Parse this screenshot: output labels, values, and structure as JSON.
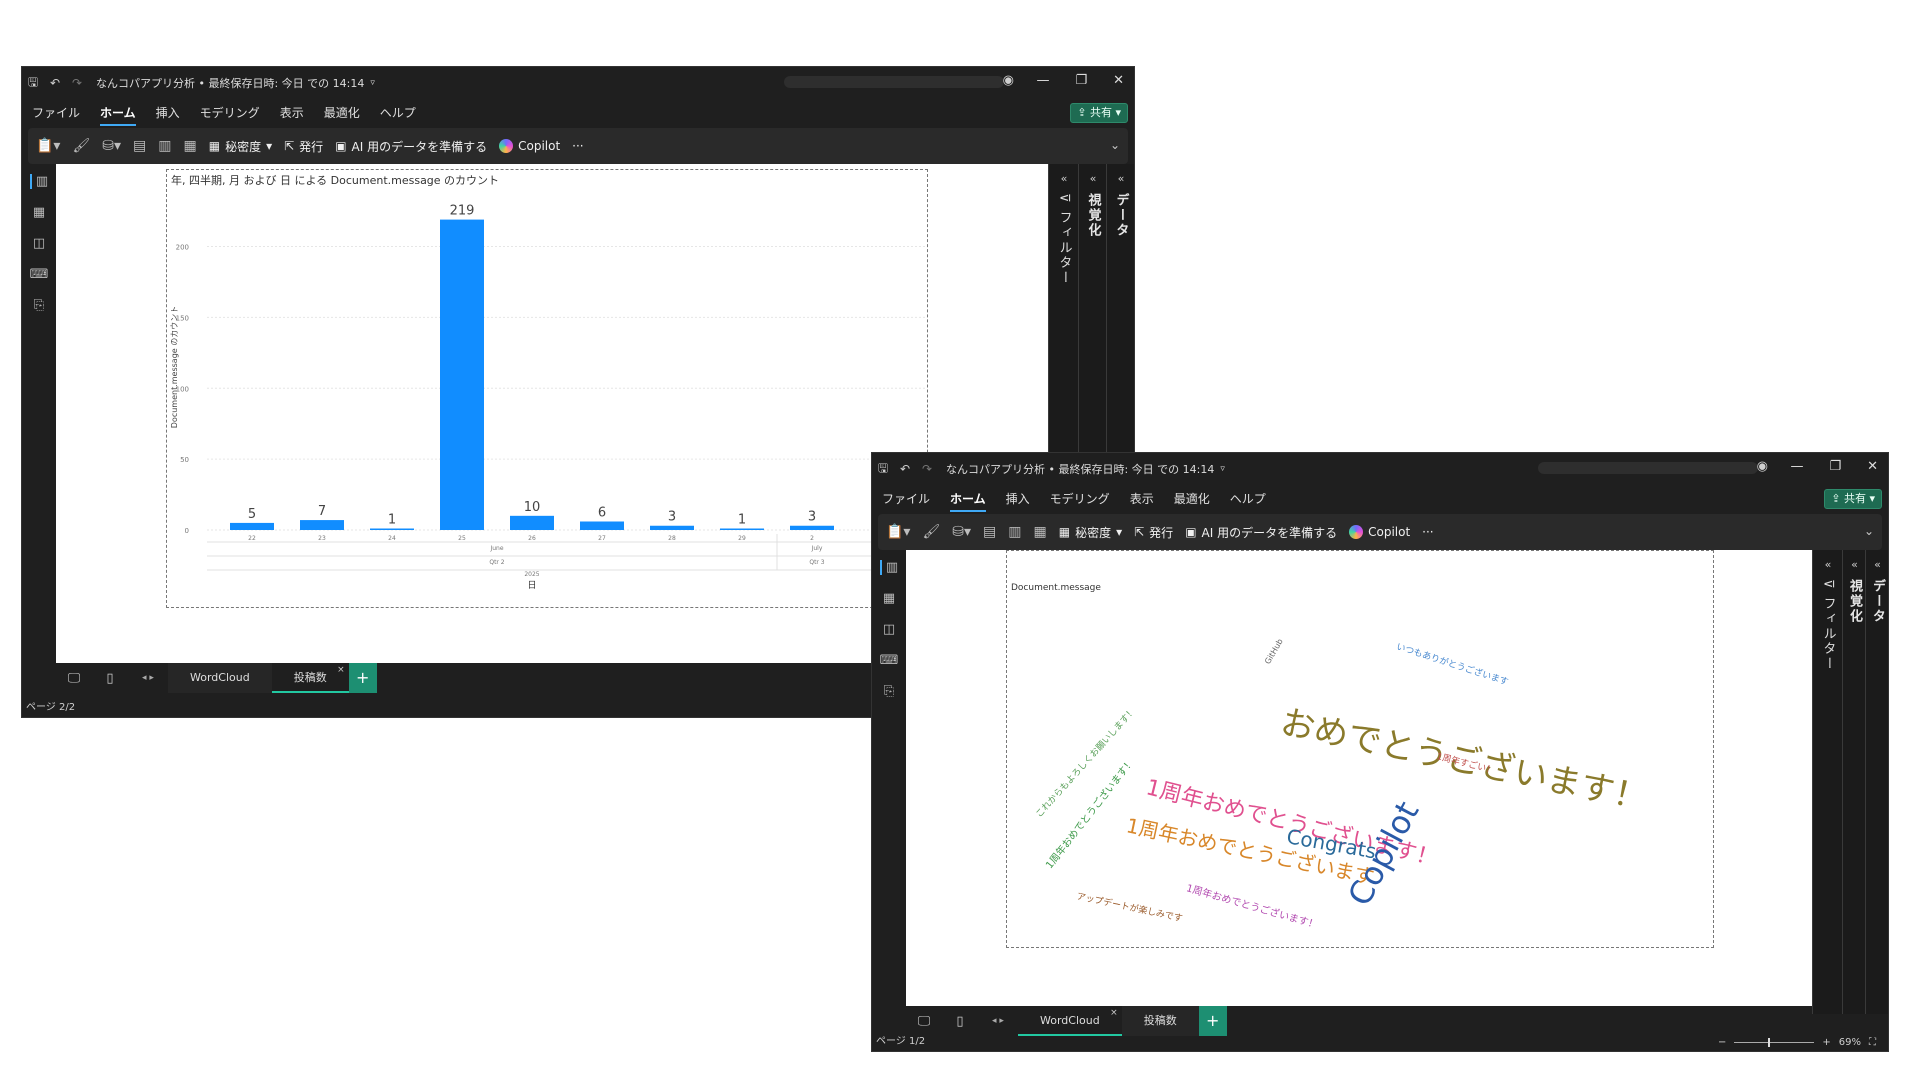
{
  "app": {
    "title": "なんコパアプリ分析 • 最終保存日時: 今日 での 14:14",
    "menu": [
      "ファイル",
      "ホーム",
      "挿入",
      "モデリング",
      "表示",
      "最適化",
      "ヘルプ"
    ],
    "active_menu": "ホーム",
    "share_label": "共有",
    "ribbon": {
      "sensitivity_label": "秘密度",
      "publish_label": "発行",
      "ai_prep_label": "AI 用のデータを準備する",
      "copilot_label": "Copilot",
      "more_label": "···"
    },
    "panes": {
      "visualizations_label": "視覚化",
      "data_label": "データ",
      "filters_label": "フィルター"
    },
    "tabs": [
      "WordCloud",
      "投稿数"
    ]
  },
  "window1": {
    "page_indicator": "ページ 2/2",
    "active_tab": "投稿数",
    "chart_title": "年, 四半期, 月 および 日 による Document.message のカウント"
  },
  "window2": {
    "page_indicator": "ページ 1/2",
    "active_tab": "WordCloud",
    "zoom_label": "69%",
    "visual_title": "Document.message",
    "words": [
      {
        "text": "おめでとうございます！",
        "color": "#8a7a2b",
        "size": 34,
        "rot": 12
      },
      {
        "text": "1周年おめでとうございます！",
        "color": "#e0508f",
        "size": 22,
        "rot": 14
      },
      {
        "text": "1周年おめでとうございます",
        "color": "#d8872a",
        "size": 20,
        "rot": 12
      },
      {
        "text": "Copilot",
        "color": "#2a5aa8",
        "size": 32,
        "rot": -62
      },
      {
        "text": "Congrats",
        "color": "#2a6a9a",
        "size": 20,
        "rot": 10
      },
      {
        "text": "1周年おめでとうございます！",
        "color": "#3e9a4a",
        "size": 10,
        "rot": -52
      },
      {
        "text": "1周年おめでとうございます！",
        "color": "#b24ab0",
        "size": 10,
        "rot": 16
      },
      {
        "text": "いつもありがとうございます",
        "color": "#4a8ad0",
        "size": 9,
        "rot": 18
      },
      {
        "text": "アップデートが楽しみです",
        "color": "#9a5a2a",
        "size": 9,
        "rot": 12
      },
      {
        "text": "これからもよろしくお願いします！",
        "color": "#5aa05a",
        "size": 9,
        "rot": -48
      },
      {
        "text": "GitHub",
        "color": "#666666",
        "size": 8,
        "rot": -60
      },
      {
        "text": "1周年すごい！",
        "color": "#c0504d",
        "size": 9,
        "rot": 14
      }
    ]
  },
  "chart_data": {
    "type": "bar",
    "title": "年, 四半期, 月 および 日 による Document.message のカウント",
    "xlabel": "日",
    "ylabel": "Document.message のカウント",
    "categories": [
      "22",
      "23",
      "24",
      "25",
      "26",
      "27",
      "28",
      "29",
      "2"
    ],
    "values": [
      5,
      7,
      1,
      219,
      10,
      6,
      3,
      1,
      3
    ],
    "ylim": [
      0,
      230
    ],
    "yticks": [
      0,
      50,
      100,
      150,
      200
    ],
    "hierarchy": {
      "year": "2025",
      "quarters": [
        "Qtr 2",
        "Qtr 3"
      ],
      "months": [
        "June",
        "July"
      ]
    },
    "bar_color": "#118dff",
    "grid": true
  }
}
